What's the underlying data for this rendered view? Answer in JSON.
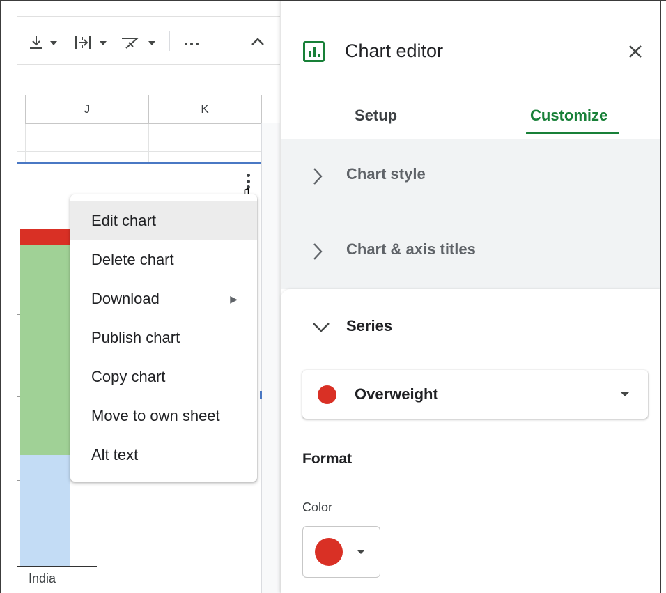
{
  "sheet": {
    "columns": [
      "J",
      "K"
    ],
    "chart_xlabel": "India"
  },
  "context_menu": {
    "items": [
      {
        "label": "Edit chart"
      },
      {
        "label": "Delete chart"
      },
      {
        "label": "Download",
        "has_submenu": true,
        "submenu_glyph": "▶"
      },
      {
        "label": "Publish chart"
      },
      {
        "label": "Copy chart"
      },
      {
        "label": "Move to own sheet"
      },
      {
        "label": "Alt text"
      }
    ]
  },
  "editor": {
    "title": "Chart editor",
    "close_icon": "close-icon",
    "tabs": [
      {
        "label": "Setup",
        "active": false
      },
      {
        "label": "Customize",
        "active": true
      }
    ],
    "sections": [
      {
        "label": "Chart style",
        "expanded": false
      },
      {
        "label": "Chart & axis titles",
        "expanded": false
      },
      {
        "label": "Series",
        "expanded": true
      }
    ],
    "series_selected": "Overweight",
    "series_color": "#d93025",
    "format_label": "Format",
    "color_label": "Color"
  },
  "colors": {
    "accent": "#188038",
    "series_red": "#d93025",
    "series_green": "#a0d196",
    "series_blue": "#c3dcf5"
  }
}
